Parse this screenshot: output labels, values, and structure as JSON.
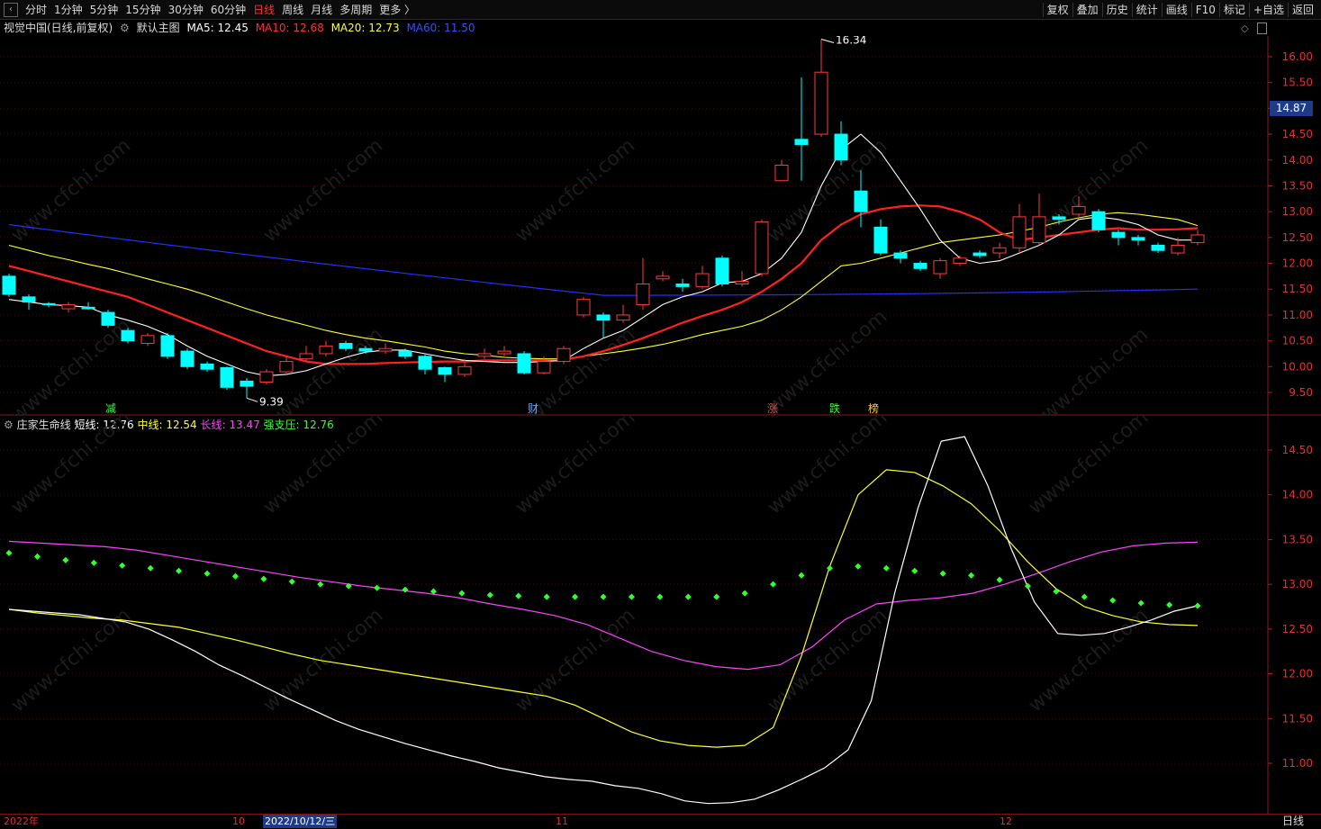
{
  "toolbar": {
    "back_icon": "chevron-left-icon",
    "periods": [
      "分时",
      "1分钟",
      "5分钟",
      "15分钟",
      "30分钟",
      "60分钟",
      "日线",
      "周线",
      "月线",
      "多周期",
      "更多 〉"
    ],
    "active_period": "日线",
    "right_buttons": [
      "复权",
      "叠加",
      "历史",
      "统计",
      "画线",
      "F10",
      "标记",
      "+自选",
      "返回"
    ]
  },
  "main_chart": {
    "stock_title": "视觉中国(日线,前复权)",
    "template_label": "默认主图",
    "ma5": "MA5: 12.45",
    "ma10": "MA10: 12.68",
    "ma20": "MA20: 12.73",
    "ma60": "MA60: 11.50",
    "last_price": "14.87",
    "high_label": "16.34",
    "low_label": "9.39",
    "price_ticks": [
      "16.00",
      "15.50",
      "15.00",
      "14.50",
      "14.00",
      "13.50",
      "13.00",
      "12.50",
      "12.00",
      "11.50",
      "11.00",
      "10.50",
      "10.00",
      "9.50"
    ],
    "markers": [
      "减",
      "财",
      "涨",
      "跌",
      "榜"
    ],
    "colors": {
      "up": "#ff3b3b",
      "down": "#00ffff",
      "ma5": "#ffffff",
      "ma10": "#ff2020",
      "ma20": "#ffff33",
      "ma60": "#2030ff"
    }
  },
  "indicator": {
    "name": "庄家生命线",
    "short_line": "短线: 12.76",
    "mid_line": "中线: 12.54",
    "long_line": "长线: 13.47",
    "support": "强支压: 12.76",
    "ticks": [
      "14.50",
      "14.00",
      "13.50",
      "13.00",
      "12.50",
      "12.00",
      "11.50",
      "11.00"
    ]
  },
  "date_axis": {
    "year_label": "2022年",
    "month_oct": "10",
    "cursor_date": "2022/10/12/三",
    "month_nov": "11",
    "month_dec": "12",
    "period_label": "日线"
  },
  "watermark": "www.cfchi.com",
  "chart_data": {
    "type": "candlestick",
    "ylim": [
      9.2,
      16.5
    ],
    "candles": [
      [
        11.75,
        11.4,
        11.8,
        11.35
      ],
      [
        11.35,
        11.25,
        11.4,
        11.1
      ],
      [
        11.22,
        11.2,
        11.25,
        11.15
      ],
      [
        11.12,
        11.2,
        11.25,
        11.05
      ],
      [
        11.15,
        11.12,
        11.25,
        11.1
      ],
      [
        11.05,
        10.8,
        11.1,
        10.75
      ],
      [
        10.7,
        10.5,
        10.75,
        10.45
      ],
      [
        10.45,
        10.6,
        10.65,
        10.4
      ],
      [
        10.6,
        10.2,
        10.65,
        10.15
      ],
      [
        10.3,
        10.0,
        10.35,
        9.95
      ],
      [
        10.05,
        9.95,
        10.1,
        9.9
      ],
      [
        9.98,
        9.6,
        10.0,
        9.55
      ],
      [
        9.72,
        9.62,
        9.78,
        9.39
      ],
      [
        9.7,
        9.9,
        9.95,
        9.65
      ],
      [
        9.9,
        10.1,
        10.2,
        9.85
      ],
      [
        10.15,
        10.25,
        10.4,
        10.1
      ],
      [
        10.25,
        10.4,
        10.5,
        10.2
      ],
      [
        10.45,
        10.35,
        10.5,
        10.3
      ],
      [
        10.35,
        10.3,
        10.4,
        10.25
      ],
      [
        10.3,
        10.35,
        10.45,
        10.25
      ],
      [
        10.3,
        10.2,
        10.35,
        10.15
      ],
      [
        10.2,
        9.95,
        10.25,
        9.85
      ],
      [
        9.98,
        9.85,
        10.0,
        9.7
      ],
      [
        9.85,
        10.0,
        10.15,
        9.8
      ],
      [
        10.2,
        10.25,
        10.35,
        10.15
      ],
      [
        10.25,
        10.3,
        10.4,
        10.2
      ],
      [
        10.25,
        9.88,
        10.3,
        9.85
      ],
      [
        9.88,
        10.1,
        10.2,
        9.85
      ],
      [
        10.1,
        10.35,
        10.4,
        10.05
      ],
      [
        11.0,
        11.3,
        11.35,
        10.95
      ],
      [
        11.0,
        10.9,
        11.05,
        10.55
      ],
      [
        10.9,
        11.0,
        11.2,
        10.85
      ],
      [
        11.2,
        11.6,
        12.1,
        11.1
      ],
      [
        11.7,
        11.75,
        11.85,
        11.65
      ],
      [
        11.6,
        11.55,
        11.7,
        11.45
      ],
      [
        11.55,
        11.8,
        11.95,
        11.5
      ],
      [
        12.1,
        11.6,
        12.15,
        11.55
      ],
      [
        11.6,
        11.65,
        11.85,
        11.55
      ],
      [
        11.8,
        12.8,
        12.85,
        11.75
      ],
      [
        13.6,
        13.9,
        14.0,
        13.9
      ],
      [
        14.4,
        14.3,
        15.6,
        13.6
      ],
      [
        14.5,
        15.7,
        16.34,
        14.45
      ],
      [
        14.5,
        14.0,
        14.75,
        13.9
      ],
      [
        13.4,
        13.0,
        13.8,
        12.7
      ],
      [
        12.7,
        12.2,
        12.85,
        12.15
      ],
      [
        12.2,
        12.1,
        12.25,
        12.0
      ],
      [
        12.0,
        11.9,
        12.05,
        11.85
      ],
      [
        11.8,
        12.05,
        12.1,
        11.7
      ],
      [
        12.0,
        12.1,
        12.15,
        11.95
      ],
      [
        12.2,
        12.15,
        12.25,
        12.1
      ],
      [
        12.2,
        12.3,
        12.4,
        12.1
      ],
      [
        12.3,
        12.9,
        13.15,
        12.2
      ],
      [
        12.4,
        12.9,
        13.35,
        12.35
      ],
      [
        12.9,
        12.85,
        12.95,
        12.75
      ],
      [
        12.95,
        13.1,
        13.3,
        12.9
      ],
      [
        13.0,
        12.65,
        13.05,
        12.6
      ],
      [
        12.6,
        12.5,
        12.65,
        12.35
      ],
      [
        12.5,
        12.45,
        12.55,
        12.35
      ],
      [
        12.35,
        12.25,
        12.4,
        12.2
      ],
      [
        12.2,
        12.35,
        12.5,
        12.15
      ],
      [
        12.4,
        12.55,
        12.65,
        12.35
      ]
    ],
    "ma5": [
      11.3,
      11.25,
      11.2,
      11.18,
      11.15,
      11.0,
      10.9,
      10.78,
      10.62,
      10.4,
      10.2,
      10.05,
      9.9,
      9.82,
      9.85,
      9.92,
      10.05,
      10.18,
      10.28,
      10.32,
      10.32,
      10.25,
      10.18,
      10.12,
      10.1,
      10.08,
      10.08,
      10.1,
      10.12,
      10.35,
      10.55,
      10.7,
      10.95,
      11.2,
      11.35,
      11.45,
      11.62,
      11.65,
      11.8,
      12.1,
      12.6,
      13.5,
      14.2,
      14.5,
      14.15,
      13.6,
      13.05,
      12.45,
      12.1,
      12.0,
      12.05,
      12.2,
      12.35,
      12.55,
      12.85,
      12.9,
      12.85,
      12.75,
      12.55,
      12.45,
      12.45
    ],
    "ma10": [
      11.95,
      11.85,
      11.75,
      11.65,
      11.55,
      11.45,
      11.35,
      11.2,
      11.05,
      10.9,
      10.75,
      10.6,
      10.45,
      10.3,
      10.2,
      10.1,
      10.05,
      10.05,
      10.05,
      10.07,
      10.08,
      10.09,
      10.1,
      10.1,
      10.12,
      10.12,
      10.12,
      10.12,
      10.13,
      10.2,
      10.3,
      10.42,
      10.55,
      10.7,
      10.85,
      10.98,
      11.1,
      11.25,
      11.45,
      11.7,
      12.0,
      12.45,
      12.75,
      12.95,
      13.05,
      13.1,
      13.12,
      13.1,
      13.0,
      12.85,
      12.6,
      12.45,
      12.5,
      12.55,
      12.6,
      12.65,
      12.68,
      12.65,
      12.65,
      12.66,
      12.68
    ],
    "ma20": [
      12.35,
      12.25,
      12.15,
      12.07,
      11.98,
      11.9,
      11.8,
      11.7,
      11.6,
      11.5,
      11.38,
      11.25,
      11.12,
      11.0,
      10.9,
      10.8,
      10.7,
      10.62,
      10.55,
      10.5,
      10.44,
      10.38,
      10.3,
      10.25,
      10.22,
      10.18,
      10.16,
      10.15,
      10.15,
      10.2,
      10.25,
      10.3,
      10.36,
      10.43,
      10.52,
      10.62,
      10.7,
      10.78,
      10.9,
      11.1,
      11.35,
      11.65,
      11.95,
      12.0,
      12.1,
      12.2,
      12.3,
      12.4,
      12.45,
      12.5,
      12.55,
      12.62,
      12.7,
      12.8,
      12.88,
      12.95,
      12.98,
      12.95,
      12.9,
      12.85,
      12.73
    ],
    "ma60_start": 12.75,
    "ma60_min": 11.38,
    "ma60_end": 11.5,
    "indicator_ylim": [
      10.6,
      14.9
    ],
    "short": [
      12.72,
      12.7,
      12.68,
      12.66,
      12.62,
      12.58,
      12.5,
      12.38,
      12.25,
      12.1,
      11.98,
      11.85,
      11.72,
      11.6,
      11.48,
      11.38,
      11.3,
      11.22,
      11.15,
      11.08,
      11.02,
      10.95,
      10.9,
      10.85,
      10.82,
      10.8,
      10.75,
      10.72,
      10.66,
      10.58,
      10.55,
      10.56,
      10.6,
      10.7,
      10.82,
      10.95,
      11.15,
      11.7,
      12.9,
      13.85,
      14.6,
      14.65,
      14.1,
      13.4,
      12.8,
      12.45,
      12.43,
      12.45,
      12.52,
      12.6,
      12.7,
      12.76
    ],
    "mid": [
      12.72,
      12.68,
      12.65,
      12.62,
      12.6,
      12.56,
      12.52,
      12.45,
      12.38,
      12.3,
      12.22,
      12.15,
      12.1,
      12.05,
      12.0,
      11.95,
      11.9,
      11.85,
      11.8,
      11.75,
      11.65,
      11.5,
      11.35,
      11.25,
      11.2,
      11.18,
      11.2,
      11.4,
      12.2,
      13.2,
      14.0,
      14.28,
      14.25,
      14.1,
      13.9,
      13.6,
      13.25,
      12.95,
      12.75,
      12.65,
      12.58,
      12.55,
      12.54
    ],
    "long": [
      13.48,
      13.46,
      13.44,
      13.42,
      13.38,
      13.32,
      13.26,
      13.2,
      13.14,
      13.08,
      13.03,
      12.98,
      12.94,
      12.9,
      12.85,
      12.78,
      12.72,
      12.65,
      12.55,
      12.4,
      12.25,
      12.15,
      12.08,
      12.05,
      12.1,
      12.3,
      12.6,
      12.78,
      12.82,
      12.85,
      12.9,
      13.0,
      13.12,
      13.25,
      13.36,
      13.43,
      13.46,
      13.47
    ],
    "support": [
      13.35,
      13.31,
      13.27,
      13.24,
      13.21,
      13.18,
      13.15,
      13.12,
      13.09,
      13.06,
      13.03,
      13.0,
      12.98,
      12.96,
      12.94,
      12.92,
      12.9,
      12.88,
      12.87,
      12.86,
      12.86,
      12.86,
      12.86,
      12.86,
      12.86,
      12.86,
      12.9,
      13.0,
      13.1,
      13.18,
      13.2,
      13.18,
      13.15,
      13.12,
      13.1,
      13.05,
      12.98,
      12.92,
      12.86,
      12.82,
      12.79,
      12.77,
      12.76
    ]
  }
}
